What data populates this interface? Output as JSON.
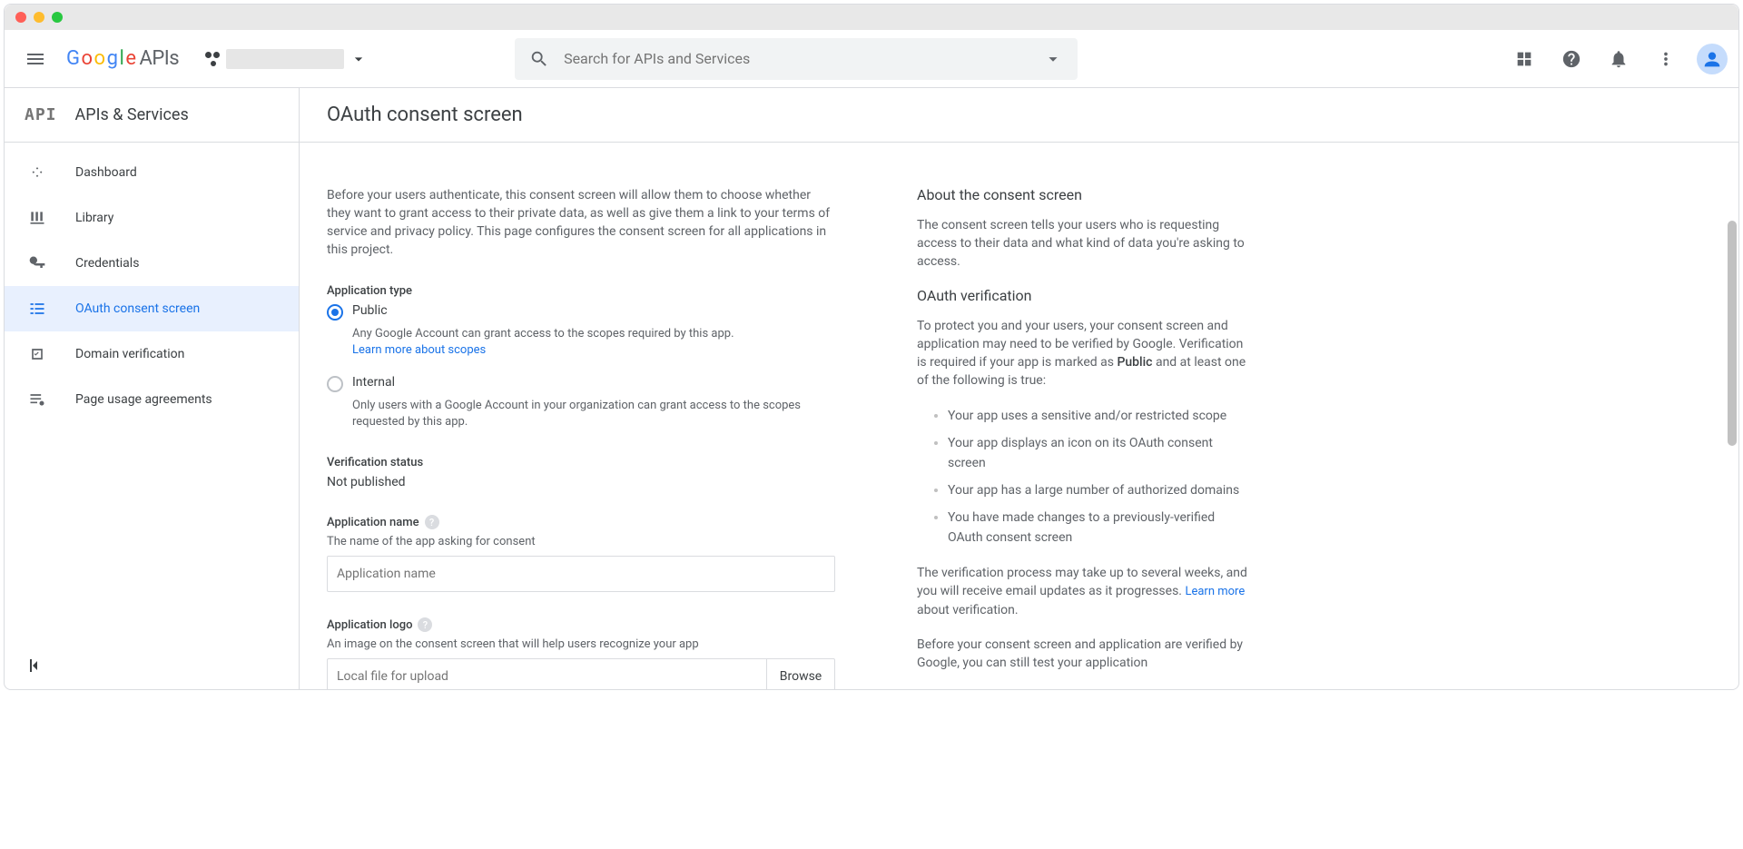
{
  "search": {
    "placeholder": "Search for APIs and Services"
  },
  "logo": {
    "apis": "APIs"
  },
  "sidebar": {
    "section": "APIs & Services",
    "logo": "API",
    "items": [
      {
        "label": "Dashboard"
      },
      {
        "label": "Library"
      },
      {
        "label": "Credentials"
      },
      {
        "label": "OAuth consent screen"
      },
      {
        "label": "Domain verification"
      },
      {
        "label": "Page usage agreements"
      }
    ]
  },
  "page": {
    "title": "OAuth consent screen",
    "intro": "Before your users authenticate, this consent screen will allow them to choose whether they want to grant access to their private data, as well as give them a link to your terms of service and privacy policy. This page configures the consent screen for all applications in this project.",
    "app_type": {
      "label": "Application type",
      "public": {
        "label": "Public",
        "desc": "Any Google Account can grant access to the scopes required by this app.",
        "more": "Learn more about scopes"
      },
      "internal": {
        "label": "Internal",
        "desc": "Only users with a Google Account in your organization can grant access to the scopes requested by this app."
      }
    },
    "status": {
      "label": "Verification status",
      "value": "Not published"
    },
    "appname": {
      "label": "Application name",
      "sub": "The name of the app asking for consent",
      "placeholder": "Application name"
    },
    "applogo": {
      "label": "Application logo",
      "sub": "An image on the consent screen that will help users recognize your app",
      "placeholder": "Local file for upload",
      "browse": "Browse"
    }
  },
  "right": {
    "about": {
      "title": "About the consent screen",
      "body": "The consent screen tells your users who is requesting access to their data and what kind of data you're asking to access."
    },
    "oauth": {
      "title": "OAuth verification",
      "intro1": "To protect you and your users, your consent screen and application may need to be verified by Google. Verification is required if your app is marked as ",
      "public": "Public",
      "intro2": " and at least one of the following is true:",
      "bullets": [
        "Your app uses a sensitive and/or restricted scope",
        "Your app displays an icon on its OAuth consent screen",
        "Your app has a large number of authorized domains",
        "You have made changes to a previously-verified OAuth consent screen"
      ],
      "p2a": "The verification process may take up to several weeks, and you will receive email updates as it progresses. ",
      "learn": "Learn more",
      "p2b": " about verification.",
      "p3": "Before your consent screen and application are verified by Google, you can still test your application"
    }
  }
}
